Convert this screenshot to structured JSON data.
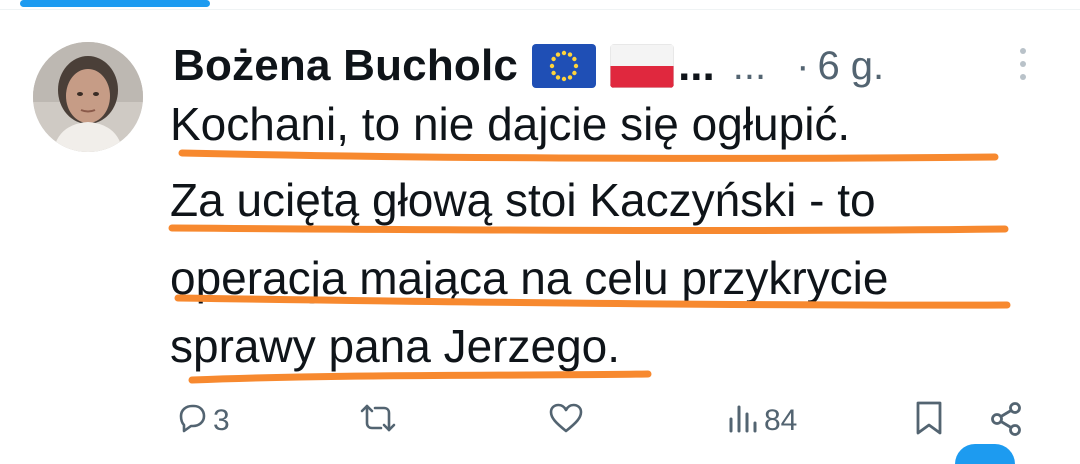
{
  "tweet": {
    "author_name": "Bożena Bucholc",
    "name_truncation": "...",
    "handle": "...",
    "separator": "·",
    "time": "6 g.",
    "lines": [
      "Kochani, to nie dajcie się ogłupić.",
      "Za uciętą głową stoi Kaczyński - to",
      "operacja mająca na celu przykrycie",
      "sprawy pana Jerzego."
    ]
  },
  "actions": {
    "reply_count": "3",
    "views_count": "84"
  },
  "icons": {
    "more": "more-vertical-icon",
    "reply": "reply-icon",
    "retweet": "retweet-icon",
    "like": "heart-icon",
    "views": "views-icon",
    "bookmark": "bookmark-icon",
    "share": "share-icon",
    "flags": [
      "eu-flag-icon",
      "poland-flag-icon"
    ]
  },
  "colors": {
    "accent": "#1d9bf0",
    "underline": "#f7892f",
    "text": "#0f1419",
    "muted": "#536471"
  }
}
